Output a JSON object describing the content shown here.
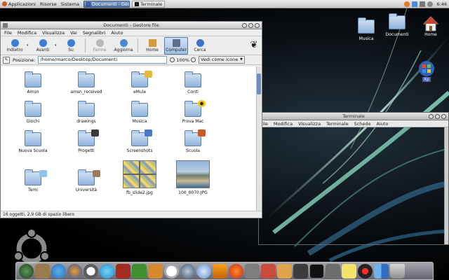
{
  "top_panel": {
    "menus": [
      "Applicazioni",
      "Risorse",
      "Sistema"
    ],
    "tasks": [
      {
        "label": "Documenti - Gestore file",
        "active": true
      },
      {
        "label": "Terminale",
        "active": false
      }
    ],
    "clock": "6:46"
  },
  "desktop_icons": [
    {
      "label": "Musica"
    },
    {
      "label": "Documenti"
    },
    {
      "label": "Home"
    },
    {
      "label": "Xp"
    }
  ],
  "nautilus": {
    "title": "Documenti - Gestore file",
    "menu": [
      "File",
      "Modifica",
      "Visualizza",
      "Vai",
      "Segnalibri",
      "Aiuto"
    ],
    "toolbar": {
      "back": "Indietro",
      "forward": "Avanti",
      "up": "Su",
      "stop": "Ferma",
      "reload": "Aggiorna",
      "home": "Home",
      "computer": "Computer",
      "search": "Cerca"
    },
    "location": {
      "label": "Posizione:",
      "path": "/home/marco/Desktop/Documenti",
      "zoom": "100%",
      "view": "Vedi come icone"
    },
    "items": [
      {
        "name": "Amsn",
        "kind": "folder",
        "emblem": ""
      },
      {
        "name": "amsn_received",
        "kind": "folder",
        "emblem": ""
      },
      {
        "name": "eMule",
        "kind": "folder",
        "emblem": "mail"
      },
      {
        "name": "Conti",
        "kind": "folder",
        "emblem": ""
      },
      {
        "name": "Giochi",
        "kind": "folder",
        "emblem": ""
      },
      {
        "name": "drawings",
        "kind": "folder",
        "emblem": ""
      },
      {
        "name": "Musica",
        "kind": "folder",
        "emblem": ""
      },
      {
        "name": "Prova Mac",
        "kind": "folder",
        "emblem": "radiation"
      },
      {
        "name": "Nuova Scuola",
        "kind": "folder",
        "emblem": ""
      },
      {
        "name": "Progetti",
        "kind": "folder",
        "emblem": "camera"
      },
      {
        "name": "Screenshots",
        "kind": "folder",
        "emblem": "people"
      },
      {
        "name": "Scuola",
        "kind": "folder",
        "emblem": "tools"
      },
      {
        "name": "Temi",
        "kind": "folder",
        "emblem": "image"
      },
      {
        "name": "Università",
        "kind": "folder",
        "emblem": "home"
      },
      {
        "name": "fb_slide2.jpg",
        "kind": "image-grid",
        "emblem": ""
      },
      {
        "name": "100_0070.JPG",
        "kind": "image-photo",
        "emblem": ""
      }
    ],
    "status": "16 oggetti, 2,9 GB di spazio libero"
  },
  "terminal": {
    "title": "Terminale",
    "menu": [
      "File",
      "Modifica",
      "Visualizza",
      "Terminale",
      "Schede",
      "Aiuto"
    ]
  },
  "dock": {
    "icons": [
      "globe-icon",
      "gimp-icon",
      "msn-icon",
      "firefox-icon",
      "clock-icon",
      "skype-icon",
      "wine-icon",
      "calendar-icon",
      "pidgin-icon",
      "golf-icon",
      "compass-icon",
      "itunes-icon",
      "vlc-icon",
      "burn-icon",
      "gimp-brush-icon",
      "appstore-icon",
      "package-icon",
      "disk-icon",
      "terminal-icon",
      "robot-icon",
      "notes-icon",
      "record-icon",
      "finder-icon",
      "trash-icon"
    ]
  },
  "colors": {
    "accent": "#4d6fa1",
    "folder_light": "#cfe0f3",
    "folder_dark": "#8fb3dc"
  }
}
